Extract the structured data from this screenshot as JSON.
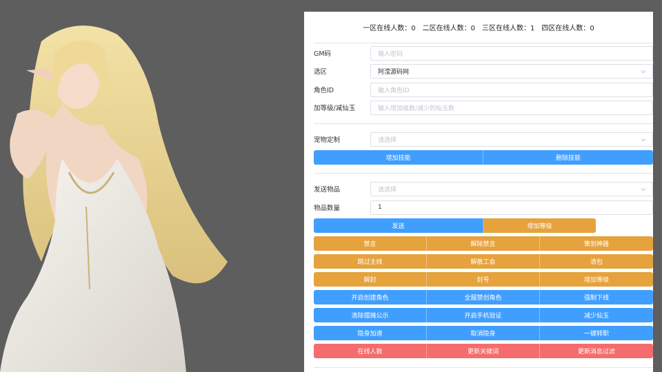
{
  "online": [
    {
      "label": "一区在线人数：",
      "value": "0"
    },
    {
      "label": "二区在线人数：",
      "value": "0"
    },
    {
      "label": "三区在线人数：",
      "value": "1"
    },
    {
      "label": "四区在线人数：",
      "value": "0"
    }
  ],
  "form": {
    "gm_label": "GM码",
    "gm_placeholder": "输入密码",
    "zone_label": "选区",
    "zone_value": "阿滢源码网",
    "role_label": "角色ID",
    "role_placeholder": "输入角色ID",
    "level_label": "加等级/减仙玉",
    "level_placeholder": "输入增加级数/减少的仙玉数"
  },
  "pet": {
    "label": "宠物定制",
    "placeholder": "请选择",
    "add_skill": "增加技能",
    "del_skill": "删除技能"
  },
  "item": {
    "label": "发送物品",
    "placeholder": "请选择",
    "qty_label": "物品数量",
    "qty_value": "1",
    "send": "发送",
    "add_level": "增加等级"
  },
  "actions": {
    "row1": [
      "禁言",
      "解除禁言",
      "策划神器"
    ],
    "row2": [
      "跳过主线",
      "解散工会",
      "清包"
    ],
    "row3": [
      "解封",
      "封号",
      "增加等级"
    ],
    "row4": [
      "开启创建角色",
      "全服禁创角色",
      "强制下线"
    ],
    "row5": [
      "清除摆摊公示",
      "开启手机验证",
      "减少仙玉"
    ],
    "row6": [
      "隐身加速",
      "取消隐身",
      "一键转职"
    ],
    "row7": [
      "在线人数",
      "更新关键词",
      "更新消息过滤"
    ]
  },
  "colors": {
    "blue": "#409eff",
    "orange": "#e6a23c",
    "red": "#f56c6c"
  }
}
